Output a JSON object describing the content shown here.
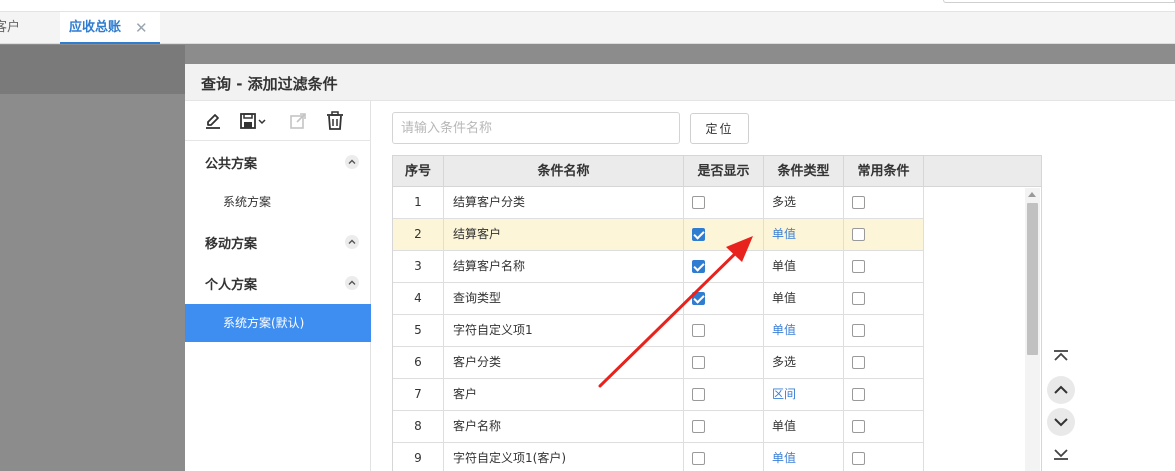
{
  "tabs": [
    {
      "label": "客户"
    },
    {
      "label": "应收总账",
      "close": "✕"
    }
  ],
  "dialog": {
    "title": "查询 - 添加过滤条件"
  },
  "toolbar": {
    "icons": [
      "edit-icon",
      "save-dropdown-icon",
      "export-icon",
      "delete-icon"
    ]
  },
  "sidebar": {
    "sections": [
      {
        "title": "公共方案",
        "items": [
          "系统方案"
        ]
      },
      {
        "title": "移动方案",
        "items": []
      },
      {
        "title": "个人方案",
        "items": [
          "系统方案(默认)"
        ]
      }
    ]
  },
  "search": {
    "placeholder": "请输入条件名称",
    "locate_label": "定位"
  },
  "table": {
    "headers": [
      "序号",
      "条件名称",
      "是否显示",
      "条件类型",
      "常用条件"
    ],
    "rows": [
      {
        "idx": "1",
        "name": "结算客户分类",
        "show": false,
        "type": "多选",
        "type_link": false,
        "common": false
      },
      {
        "idx": "2",
        "name": "结算客户",
        "show": true,
        "type": "单值",
        "type_link": true,
        "common": false
      },
      {
        "idx": "3",
        "name": "结算客户名称",
        "show": true,
        "type": "单值",
        "type_link": false,
        "common": false
      },
      {
        "idx": "4",
        "name": "查询类型",
        "show": true,
        "type": "单值",
        "type_link": false,
        "common": false
      },
      {
        "idx": "5",
        "name": "字符自定义项1",
        "show": false,
        "type": "单值",
        "type_link": true,
        "common": false
      },
      {
        "idx": "6",
        "name": "客户分类",
        "show": false,
        "type": "多选",
        "type_link": false,
        "common": false
      },
      {
        "idx": "7",
        "name": "客户",
        "show": false,
        "type": "区间",
        "type_link": true,
        "common": false
      },
      {
        "idx": "8",
        "name": "客户名称",
        "show": false,
        "type": "单值",
        "type_link": false,
        "common": false
      },
      {
        "idx": "9",
        "name": "字符自定义项1(客户)",
        "show": false,
        "type": "单值",
        "type_link": true,
        "common": false
      }
    ]
  },
  "colors": {
    "accent": "#2f7dd1",
    "highlight_row": "#fcf5d8",
    "selected_item": "#3e8ef2",
    "annotation_arrow": "#e8221c"
  }
}
